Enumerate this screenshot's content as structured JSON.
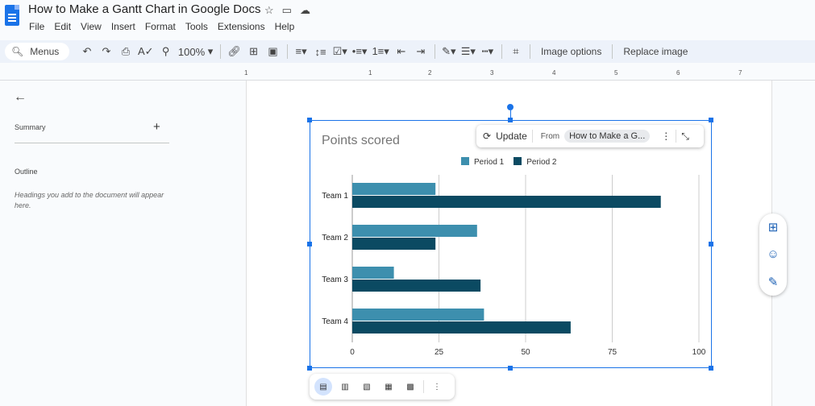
{
  "app": {
    "title": "How to Make a Gantt Chart in Google Docs",
    "menus": [
      "File",
      "Edit",
      "View",
      "Insert",
      "Format",
      "Tools",
      "Extensions",
      "Help"
    ]
  },
  "toolbar": {
    "search_label": "Menus",
    "zoom": "100%",
    "image_options": "Image options",
    "replace_image": "Replace image"
  },
  "ruler": {
    "labels": [
      "1",
      "1",
      "2",
      "3",
      "4",
      "5",
      "6",
      "7"
    ]
  },
  "sidebar": {
    "summary": "Summary",
    "outline": "Outline",
    "hint": "Headings you add to the document will appear here."
  },
  "linked_chart": {
    "update": "Update",
    "from": "From",
    "source": "How to Make a G..."
  },
  "chart_data": {
    "type": "bar",
    "orientation": "horizontal",
    "title": "Points scored",
    "categories": [
      "Team 1",
      "Team 2",
      "Team 3",
      "Team 4"
    ],
    "series": [
      {
        "name": "Period 1",
        "color": "#3d8fae",
        "values": [
          24,
          36,
          12,
          38
        ]
      },
      {
        "name": "Period 2",
        "color": "#0b4a62",
        "values": [
          89,
          24,
          37,
          63
        ]
      }
    ],
    "xlim": [
      0,
      100
    ],
    "xticks": [
      "0",
      "25",
      "50",
      "75",
      "100"
    ],
    "grid": true,
    "legend": "top"
  },
  "colors": {
    "accent": "#1a73e8"
  }
}
